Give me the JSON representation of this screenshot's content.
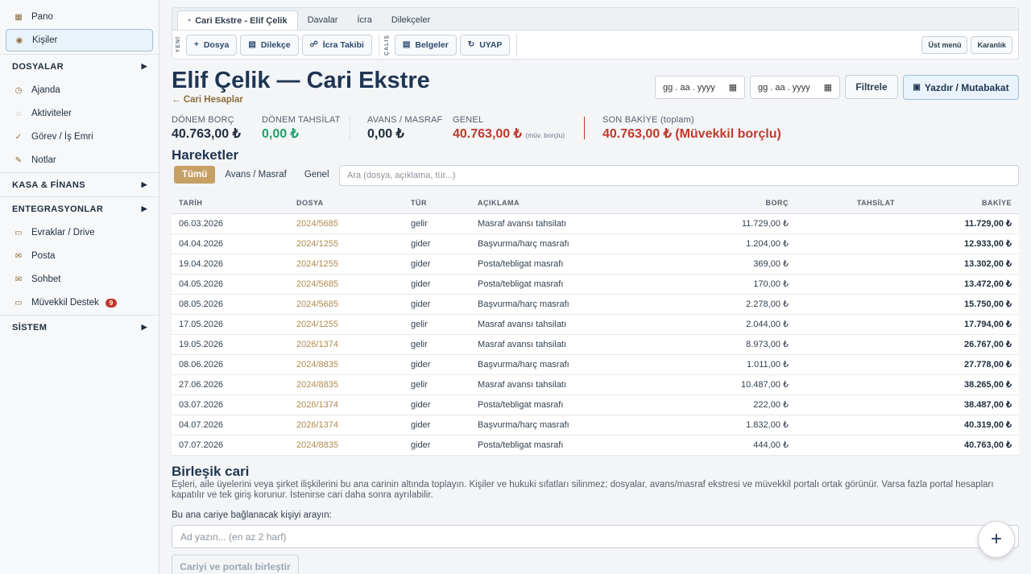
{
  "sidebar": {
    "items_top": [
      {
        "label": "Pano",
        "icon": "dashboard-icon",
        "glyph": "▦"
      },
      {
        "label": "Kişiler",
        "icon": "people-icon",
        "glyph": "◉"
      }
    ],
    "sec_dosyalar": "DOSYALAR",
    "items_dosyalar": [
      {
        "label": "Ajanda",
        "icon": "agenda-icon",
        "glyph": "◷"
      },
      {
        "label": "Aktiviteler",
        "icon": "activity-icon",
        "glyph": "◌"
      },
      {
        "label": "Görev / İş Emri",
        "icon": "check-icon",
        "glyph": "✓"
      },
      {
        "label": "Notlar",
        "icon": "pen-icon",
        "glyph": "✎"
      }
    ],
    "sec_kasa": "KASA & FİNANS",
    "sec_entegrasyon": "ENTEGRASYONLAR",
    "items_entegrasyon": [
      {
        "label": "Evraklar / Drive",
        "icon": "folder-icon",
        "glyph": "▭"
      },
      {
        "label": "Posta",
        "icon": "mail-icon",
        "glyph": "✉"
      },
      {
        "label": "Sohbet",
        "icon": "chat-icon",
        "glyph": "✉"
      },
      {
        "label": "Müvekkil Destek",
        "icon": "support-icon",
        "glyph": "▭"
      }
    ],
    "support_badge": "9",
    "sec_sistem": "SİSTEM",
    "arrow": "▶"
  },
  "tabs": {
    "active": "Cari Ekstre - Elif Çelik",
    "items": [
      "Davalar",
      "İcra",
      "Dilekçeler"
    ]
  },
  "toolbar": {
    "new_label": "YENİ",
    "work_label": "ÇALIŞ",
    "dosya": "Dosya",
    "dilekce": "Dilekçe",
    "icra_takibi": "İcra Takibi",
    "belgeler": "Belgeler",
    "uyap": "UYAP",
    "ust_menu": "Üst menü",
    "karanlik": "Karanlık"
  },
  "header": {
    "title": "Elif Çelik — Cari Ekstre",
    "back": "← Cari Hesaplar",
    "date_placeholder": "gg . aa . yyyy",
    "filter": "Filtrele",
    "print": "Yazdır / Mutabakat"
  },
  "stats": {
    "borc_label": "DÖNEM BORÇ",
    "borc_value": "40.763,00 ₺",
    "tahsilat_label": "DÖNEM TAHSİLAT",
    "tahsilat_value": "0,00 ₺",
    "avans_label": "AVANS / MASRAF",
    "avans_value": "0,00 ₺",
    "genel_label": "GENEL",
    "genel_value": "40.763,00 ₺",
    "genel_note": "(müv. borçlu)",
    "son_label": "SON BAKİYE (toplam)",
    "son_value": "40.763,00 ₺ (Müvekkil borçlu)"
  },
  "movements": {
    "title": "Hareketler",
    "filters": [
      "Tümü",
      "Avans / Masraf",
      "Genel"
    ],
    "search_placeholder": "Ara (dosya, açıklama, tür...)",
    "columns": [
      "TARİH",
      "DOSYA",
      "TÜR",
      "AÇIKLAMA",
      "BORÇ",
      "TAHSİLAT",
      "BAKİYE"
    ],
    "rows": [
      [
        "06.03.2026",
        "2024/5685",
        "gelir",
        "Masraf avansı tahsilatı",
        "11.729,00 ₺",
        "",
        "11.729,00 ₺"
      ],
      [
        "04.04.2026",
        "2024/1255",
        "gider",
        "Başvurma/harç masrafı",
        "1.204,00 ₺",
        "",
        "12.933,00 ₺"
      ],
      [
        "19.04.2026",
        "2024/1255",
        "gider",
        "Posta/tebligat masrafı",
        "369,00 ₺",
        "",
        "13.302,00 ₺"
      ],
      [
        "04.05.2026",
        "2024/5685",
        "gider",
        "Posta/tebligat masrafı",
        "170,00 ₺",
        "",
        "13.472,00 ₺"
      ],
      [
        "08.05.2026",
        "2024/5685",
        "gider",
        "Başvurma/harç masrafı",
        "2.278,00 ₺",
        "",
        "15.750,00 ₺"
      ],
      [
        "17.05.2026",
        "2024/1255",
        "gelir",
        "Masraf avansı tahsilatı",
        "2.044,00 ₺",
        "",
        "17.794,00 ₺"
      ],
      [
        "19.05.2026",
        "2026/1374",
        "gelir",
        "Masraf avansı tahsilatı",
        "8.973,00 ₺",
        "",
        "26.767,00 ₺"
      ],
      [
        "08.06.2026",
        "2024/8835",
        "gider",
        "Başvurma/harç masrafı",
        "1.011,00 ₺",
        "",
        "27.778,00 ₺"
      ],
      [
        "27.06.2026",
        "2024/8835",
        "gelir",
        "Masraf avansı tahsilatı",
        "10.487,00 ₺",
        "",
        "38.265,00 ₺"
      ],
      [
        "03.07.2026",
        "2026/1374",
        "gider",
        "Posta/tebligat masrafı",
        "222,00 ₺",
        "",
        "38.487,00 ₺"
      ],
      [
        "04.07.2026",
        "2026/1374",
        "gider",
        "Başvurma/harç masrafı",
        "1.832,00 ₺",
        "",
        "40.319,00 ₺"
      ],
      [
        "07.07.2026",
        "2024/8835",
        "gider",
        "Posta/tebligat masrafı",
        "444,00 ₺",
        "",
        "40.763,00 ₺"
      ]
    ]
  },
  "merge": {
    "title": "Birleşik cari",
    "desc": "Eşleri, aile üyelerini veya şirket ilişkilerini bu ana carinin altında toplayın. Kişiler ve hukuki sıfatları silinmez; dosyalar, avans/masraf ekstresi ve müvekkil portalı ortak görünür. Varsa fazla portal hesapları kapatılır ve tek giriş korunur. İstenirse cari daha sonra ayrılabilir.",
    "search_label": "Bu ana cariye bağlanacak kişiyi arayın:",
    "search_placeholder": "Ad yazın... (en az 2 harf)",
    "button": "Cariyi ve portalı birleştir"
  },
  "fab": "+"
}
